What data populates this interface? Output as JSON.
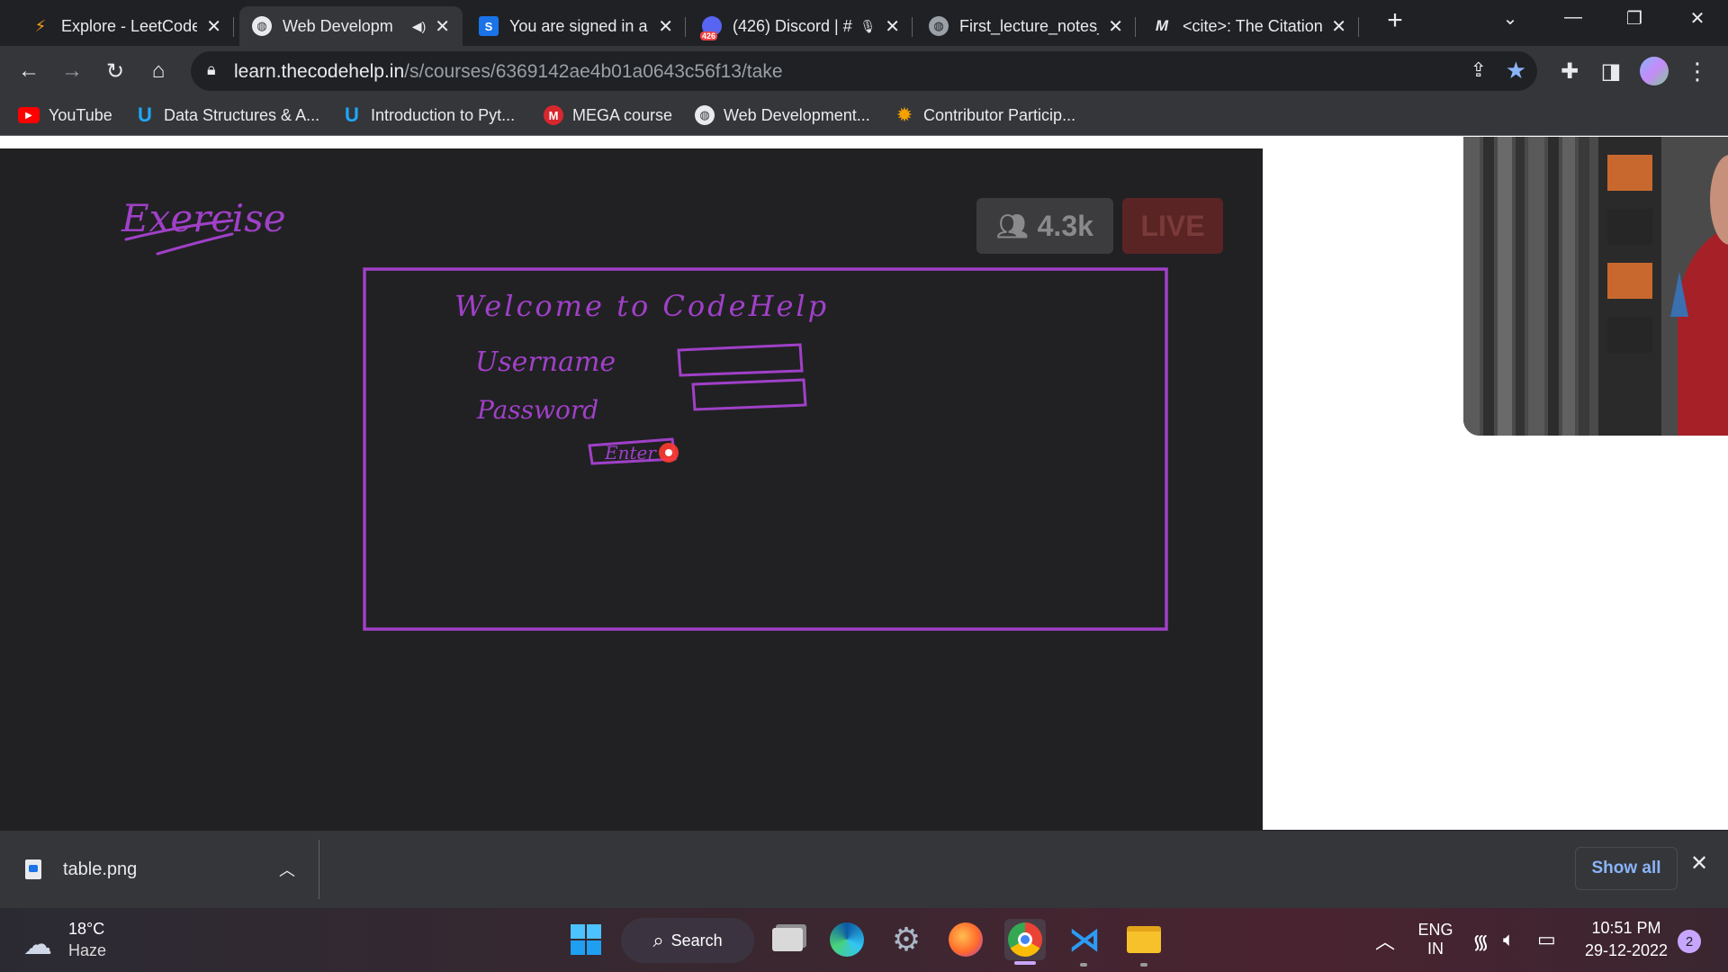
{
  "tabs": [
    {
      "title": "Explore - LeetCode",
      "icon": "leetcode-icon",
      "active": false
    },
    {
      "title": "Web Developm",
      "icon": "globe-icon",
      "active": true,
      "audio": true
    },
    {
      "title": "You are signed in a",
      "icon": "s-icon",
      "active": false
    },
    {
      "title": "(426) Discord | #",
      "icon": "discord-icon",
      "active": false,
      "badge": "426"
    },
    {
      "title": "First_lecture_notes_",
      "icon": "globe-icon",
      "active": false
    },
    {
      "title": "<cite>: The Citation",
      "icon": "mdn-icon",
      "active": false
    }
  ],
  "omnibox": {
    "host": "learn.thecodehelp.in",
    "path": "/s/courses/6369142ae4b01a0643c56f13/take"
  },
  "bookmarks": [
    {
      "label": "YouTube",
      "icon": "youtube-icon",
      "color": "#ff0000"
    },
    {
      "label": "Data Structures & A...",
      "icon": "udemy-icon",
      "color": "#1ea7fd"
    },
    {
      "label": "Introduction to Pyt...",
      "icon": "udemy-icon",
      "color": "#1ea7fd"
    },
    {
      "label": "MEGA course",
      "icon": "mega-icon",
      "color": "#d9272e"
    },
    {
      "label": "Web Development...",
      "icon": "globe-icon",
      "color": "#e8eaed"
    },
    {
      "label": "Contributor Particip...",
      "icon": "gear-badge-icon",
      "color": "#f4a100"
    }
  ],
  "video": {
    "viewers": "4.3k",
    "live_label": "LIVE",
    "whiteboard": {
      "heading": "Exercise",
      "welcome_line": "Welcome to CodeHelp",
      "field_1": "Username",
      "field_2": "Password",
      "button": "Enter",
      "ink_color": "#a040c8"
    }
  },
  "download_bar": {
    "file": "table.png",
    "show_all": "Show all"
  },
  "taskbar": {
    "weather_temp": "18°C",
    "weather_desc": "Haze",
    "search_label": "Search",
    "lang_top": "ENG",
    "lang_bottom": "IN",
    "time": "10:51 PM",
    "date": "29-12-2022",
    "notifications": "2"
  }
}
